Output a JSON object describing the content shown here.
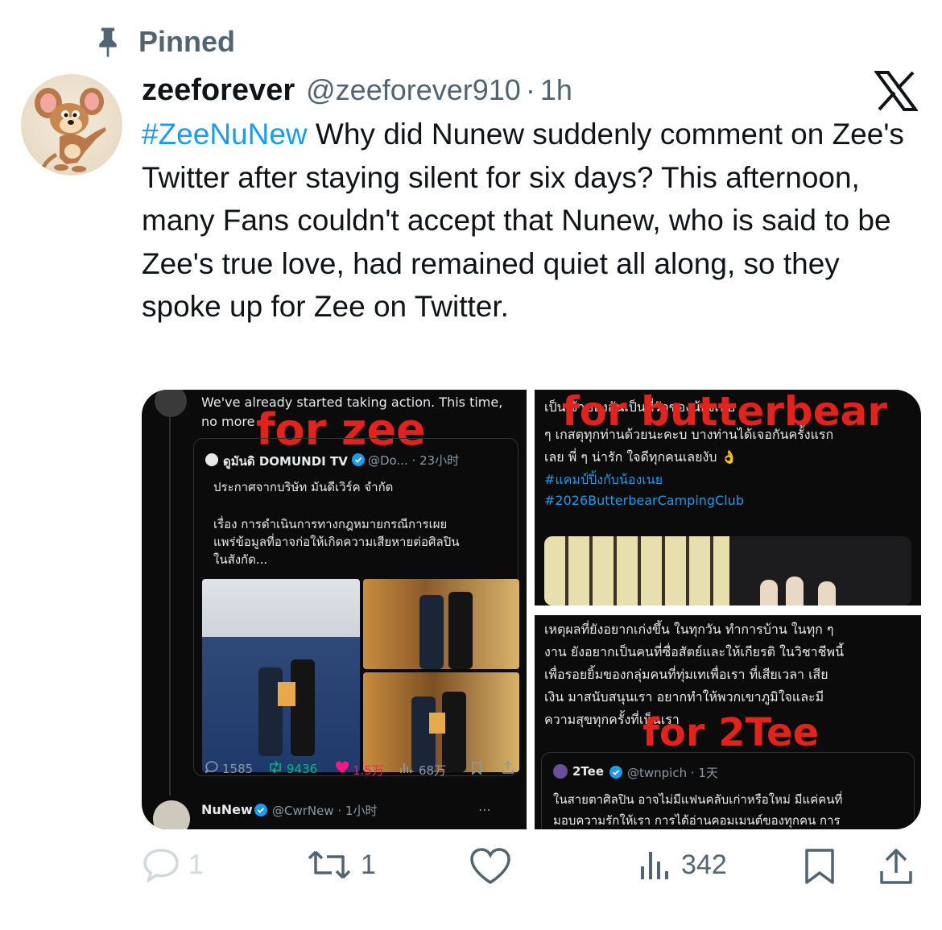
{
  "pinned": {
    "label": "Pinned",
    "icon": "pin-icon"
  },
  "tweet": {
    "display_name": "zeeforever",
    "handle": "@zeeforever910",
    "separator": "·",
    "time": "1h",
    "hashtag": "#ZeeNuNew",
    "text": " Why did Nunew suddenly comment on Zee's Twitter after staying silent for six days? This afternoon, many Fans couldn't accept that Nunew, who is said to be Zee's true love, had remained quiet all along, so they spoke up for Zee on Twitter."
  },
  "media": {
    "left": {
      "top_text_1": "We've already started taking action. This time,",
      "top_text_2": "no more",
      "overlay": "for zee",
      "quote_name": "ดูมันดิ DOMUNDI TV",
      "quote_handle": "@Do... · 23小时",
      "quote_line_1": "ประกาศจากบริษัท มันดีเวิร์ค จำกัด",
      "quote_line_2": "เรื่อง การดำเนินการทางกฎหมายกรณีการเผย",
      "quote_line_3": "แพร่ข้อมูลที่อาจก่อให้เกิดความเสียหายต่อศิลปิน",
      "quote_line_4": "ในสังกัด...",
      "stat_replies": "1585",
      "stat_reposts": "9436",
      "stat_likes": "1.5万",
      "stat_views": "68万",
      "reply_name": "NuNew",
      "reply_handle": "@CwrNew · 1小时"
    },
    "top_right": {
      "overlay": "for butterbear",
      "line_1": "เป็นเจ้าของอันเป็นที่รักของน้องเนย",
      "line_2": "ๆ เกสตุทุกท่านด้วยนะคะบ บางท่านได้เจอกันครั้งแรก",
      "line_3": "เลย พี่ ๆ น่ารัก ใจดีทุกคนเลยงับ 👌",
      "tag_1": "#แคมป์ปิ้งกับน้องเนย",
      "tag_2": "#2026ButterbearCampingClub"
    },
    "bottom_right": {
      "overlay": "for 2Tee",
      "line_1": "เหตุผลที่ยังอยากเก่งขึ้น ในทุกวัน ทำการบ้าน ในทุก ๆ",
      "line_2": "งาน ยังอยากเป็นคนที่ซื่อสัตย์และให้เกียรติ ในวิชาชีพนี้",
      "line_3": "เพื่อรอยยิ้มของกลุ่มคนที่ทุ่มเทเพื่อเรา ที่เสียเวลา เสีย",
      "line_4": "เงิน มาสนับสนุนเรา อยากทำให้พวกเขาภูมิใจและมี",
      "line_5": "ความสุขทุกครั้งที่เห็นเรา",
      "quote_name": "2Tee",
      "quote_handle": "@twnpich · 1天",
      "quote_line_1": "ในสายตาศิลปิน อาจไม่มีแฟนคลับเก่าหรือใหม่ มีแค่คนที่",
      "quote_line_2": "มอบความรักให้เรา การได้อ่านคอมเมนต์ของทุกคน การ"
    }
  },
  "actions": {
    "replies": "1",
    "reposts": "1",
    "views": "342"
  },
  "colors": {
    "hashtag": "#1d9bf0",
    "secondary_text": "#536471",
    "overlay_red": "#e0231c"
  }
}
